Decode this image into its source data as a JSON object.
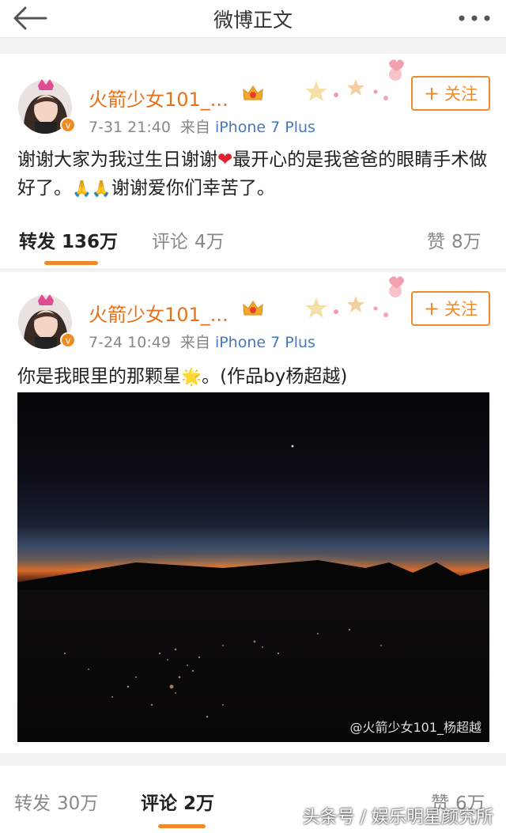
{
  "header": {
    "title": "微博正文"
  },
  "posts": [
    {
      "username": "火箭少女101_...",
      "date": "7-31 21:40",
      "source_prefix": "来自",
      "device": "iPhone 7 Plus",
      "follow_label": "关注",
      "text_part1": "谢谢大家为我过生日谢谢",
      "text_part2": "最开心的是我爸爸的眼睛手术做好了。",
      "text_part3": "谢谢爱你们幸苦了。",
      "emoji_heart": "❤",
      "emoji_pray": "🙏🙏",
      "actions": {
        "repost_label": "转发",
        "repost_count": "136万",
        "comment_label": "评论",
        "comment_count": "4万",
        "like_label": "赞",
        "like_count": "8万"
      }
    },
    {
      "username": "火箭少女101_...",
      "date": "7-24 10:49",
      "source_prefix": "来自",
      "device": "iPhone 7 Plus",
      "follow_label": "关注",
      "text_part1": "你是我眼里的那颗星",
      "emoji_star": "🌟",
      "text_part2": "。(作品by杨超越)",
      "image_watermark": "@火箭少女101_杨超越",
      "actions": {
        "repost_label": "转发",
        "repost_count": "30万",
        "comment_label": "评论",
        "comment_count": "2万",
        "like_label": "赞",
        "like_count": "6万"
      }
    }
  ],
  "footer_watermark": "头条号 / 娱乐明星颜究所",
  "colors": {
    "accent": "#f08a2a",
    "username": "#e8711a",
    "device_link": "#4a78b8"
  }
}
